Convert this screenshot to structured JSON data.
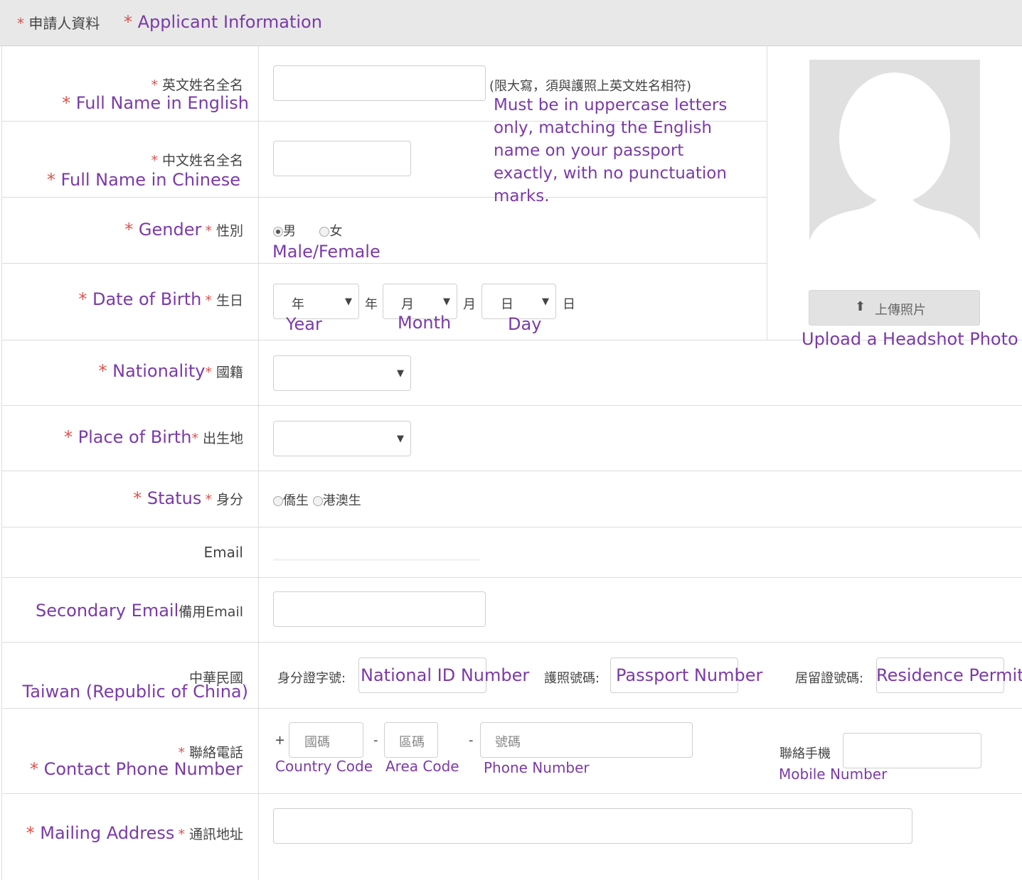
{
  "header": {
    "title_zh": "申請人資料",
    "title_en": "Applicant Information",
    "star": "*"
  },
  "fields": {
    "name_en": {
      "label_zh": "英文姓名全名",
      "label_en": "Full Name in English",
      "hint_zh": "(限大寫，須與護照上英文姓名相符)",
      "hint_en": [
        "Must be in uppercase letters",
        "only, matching the English",
        "name on your passport",
        "exactly, with no punctuation",
        "marks."
      ],
      "value": ""
    },
    "name_zh": {
      "label_zh": "中文姓名全名",
      "label_en": "Full Name in Chinese",
      "value": ""
    },
    "gender": {
      "label_en": "Gender",
      "label_zh": "性別",
      "options": [
        "男",
        "女"
      ],
      "selected": "男",
      "note_en": "Male/Female"
    },
    "dob": {
      "label_en": "Date of Birth",
      "label_zh": "生日",
      "year": {
        "placeholder": "年",
        "suffix": "年",
        "note_en": "Year"
      },
      "month": {
        "placeholder": "月",
        "suffix": "月",
        "note_en": "Month"
      },
      "day": {
        "placeholder": "日",
        "suffix": "日",
        "note_en": "Day"
      }
    },
    "nationality": {
      "label_en": "Nationality",
      "label_zh": "國籍",
      "value": ""
    },
    "birthplace": {
      "label_en": "Place of Birth",
      "label_zh": "出生地",
      "value": ""
    },
    "status": {
      "label_en": "Status",
      "label_zh": "身分",
      "options": [
        "僑生",
        "港澳生"
      ]
    },
    "email": {
      "label": "Email",
      "value": ""
    },
    "secondary_email": {
      "label_en": "Secondary Email",
      "label_zh": "備用Email",
      "value": ""
    },
    "roc": {
      "label_zh": "中華民國",
      "label_en": "Taiwan (Republic of China)",
      "id_label": "身分證字號:",
      "id_note": "National ID Number",
      "passport_label": "護照號碼:",
      "passport_note": "Passport Number",
      "residence_label": "居留證號碼:",
      "residence_note": "Residence Permit"
    },
    "phone": {
      "label_zh": "聯絡電話",
      "label_en": "Contact Phone Number",
      "plus": "+",
      "dash": "-",
      "country_placeholder": "國碼",
      "area_placeholder": "區碼",
      "number_placeholder": "號碼",
      "country_note": "Country Code",
      "area_note": "Area Code",
      "number_note": "Phone Number",
      "mobile_label": "聯絡手機",
      "mobile_note": "Mobile Number"
    },
    "address": {
      "label_en": "Mailing Address",
      "label_zh": "通訊地址",
      "value": ""
    }
  },
  "photo": {
    "upload_label": "上傳照片",
    "note_en": "Upload a Headshot Photo"
  },
  "colors": {
    "accent": "#7b3aa8",
    "required": "#d9534f",
    "header_bg": "#e8e8e8",
    "border": "#dcdcdc"
  }
}
